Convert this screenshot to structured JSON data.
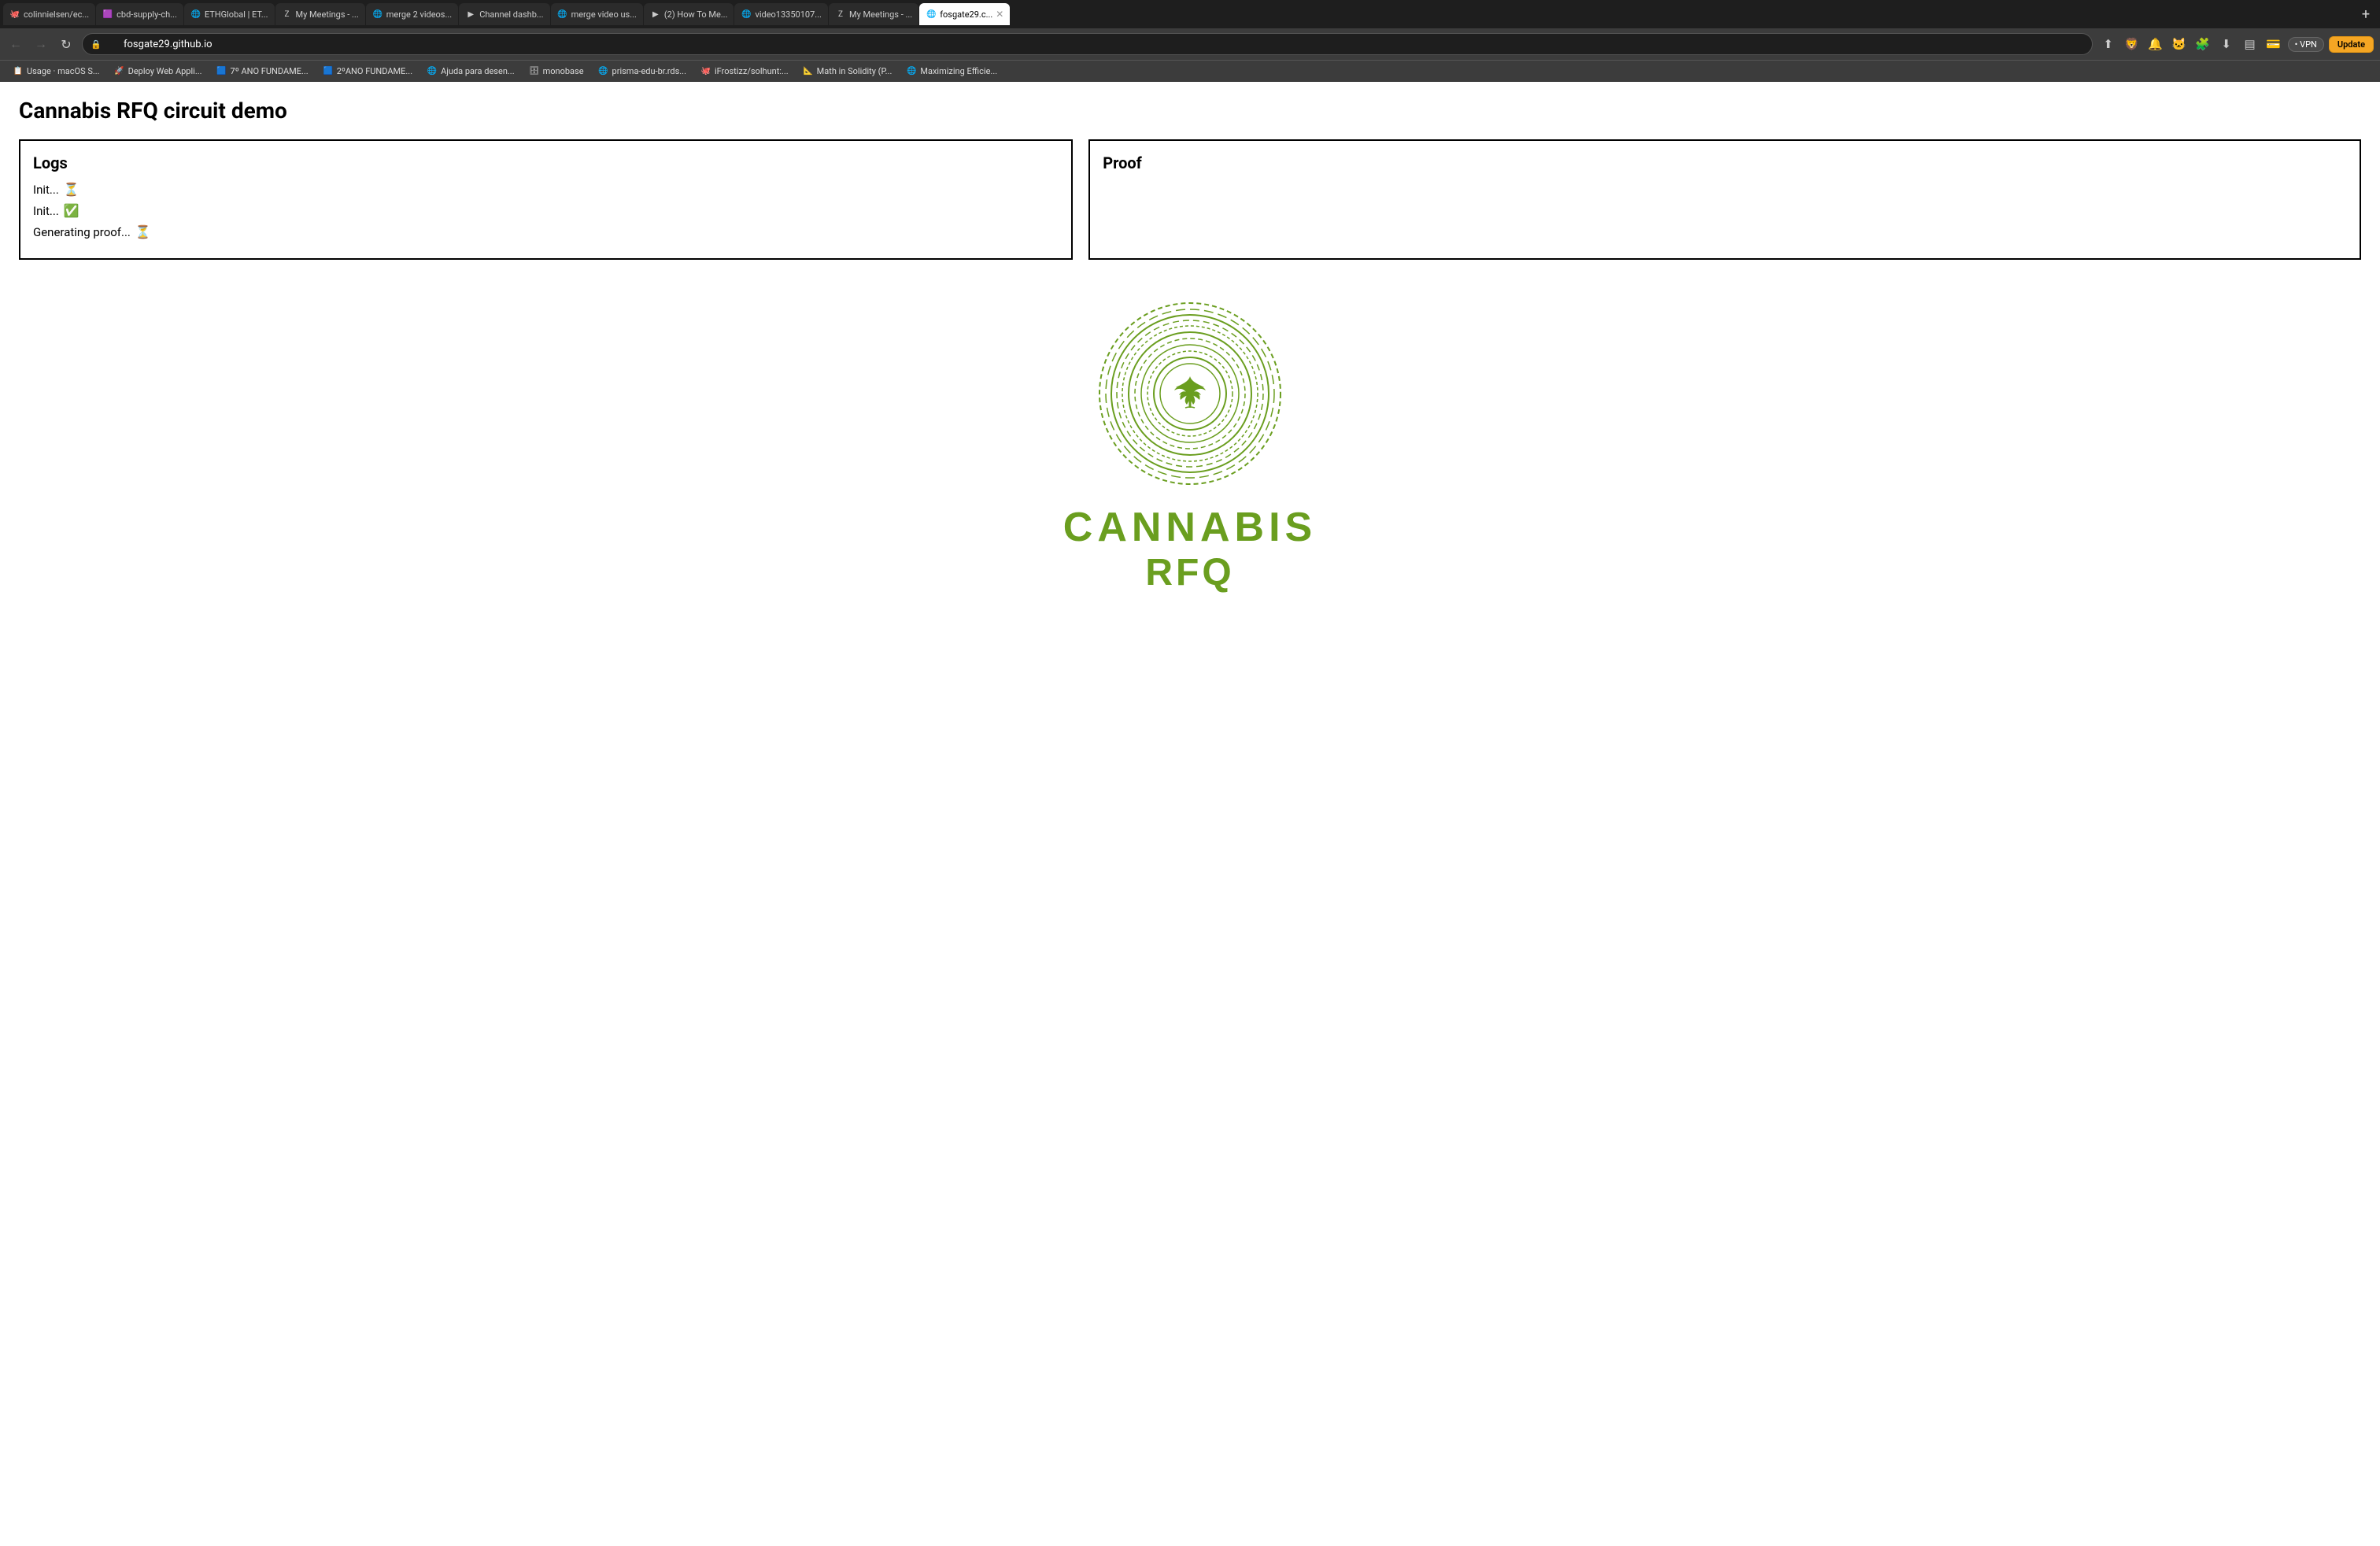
{
  "browser": {
    "url": "fosgate29.github.io",
    "tabs": [
      {
        "id": "t1",
        "favicon": "🐙",
        "label": "colinnielsen/ec...",
        "active": false
      },
      {
        "id": "t2",
        "favicon": "🟪",
        "label": "cbd-supply-ch...",
        "active": false
      },
      {
        "id": "t3",
        "favicon": "🌐",
        "label": "ETHGlobal | ET...",
        "active": false
      },
      {
        "id": "t4",
        "favicon": "Z",
        "label": "My Meetings - ...",
        "active": false
      },
      {
        "id": "t5",
        "favicon": "🌐",
        "label": "merge 2 videos...",
        "active": false
      },
      {
        "id": "t6",
        "favicon": "▶",
        "label": "Channel dashb...",
        "active": false
      },
      {
        "id": "t7",
        "favicon": "🌐",
        "label": "merge video us...",
        "active": false
      },
      {
        "id": "t8",
        "favicon": "▶",
        "label": "(2) How To Me...",
        "active": false
      },
      {
        "id": "t9",
        "favicon": "🌐",
        "label": "video13350107...",
        "active": false
      },
      {
        "id": "t10",
        "favicon": "Z",
        "label": "My Meetings - ...",
        "active": false
      },
      {
        "id": "t11",
        "favicon": "🌐",
        "label": "fosgate29.c...",
        "active": true
      }
    ],
    "new_tab_label": "+",
    "bookmarks": [
      {
        "favicon": "📋",
        "label": "Usage · macOS S..."
      },
      {
        "favicon": "🚀",
        "label": "Deploy Web Appli..."
      },
      {
        "favicon": "🟦",
        "label": "7º ANO FUNDAME..."
      },
      {
        "favicon": "🟦",
        "label": "2ºANO FUNDAME..."
      },
      {
        "favicon": "🌐",
        "label": "Ajuda para desen..."
      },
      {
        "favicon": "🗄",
        "label": "monobase"
      },
      {
        "favicon": "🌐",
        "label": "prisma-edu-br.rds..."
      },
      {
        "favicon": "🐙",
        "label": "iFrostizz/solhunt:..."
      },
      {
        "favicon": "📐",
        "label": "Math in Solidity (P..."
      },
      {
        "favicon": "🌐",
        "label": "Maximizing Efficie..."
      }
    ],
    "vpn_label": "• VPN",
    "update_label": "Update"
  },
  "page": {
    "title": "Cannabis RFQ circuit demo",
    "logs_panel": {
      "heading": "Logs",
      "entries": [
        {
          "text": "Init...",
          "emoji": "⏳"
        },
        {
          "text": "Init...",
          "emoji": "✅"
        },
        {
          "text": "Generating proof...",
          "emoji": "⏳"
        }
      ]
    },
    "proof_panel": {
      "heading": "Proof"
    },
    "logo": {
      "cannabis_word": "CANNABIS",
      "rfq_word": "RFQ"
    }
  }
}
